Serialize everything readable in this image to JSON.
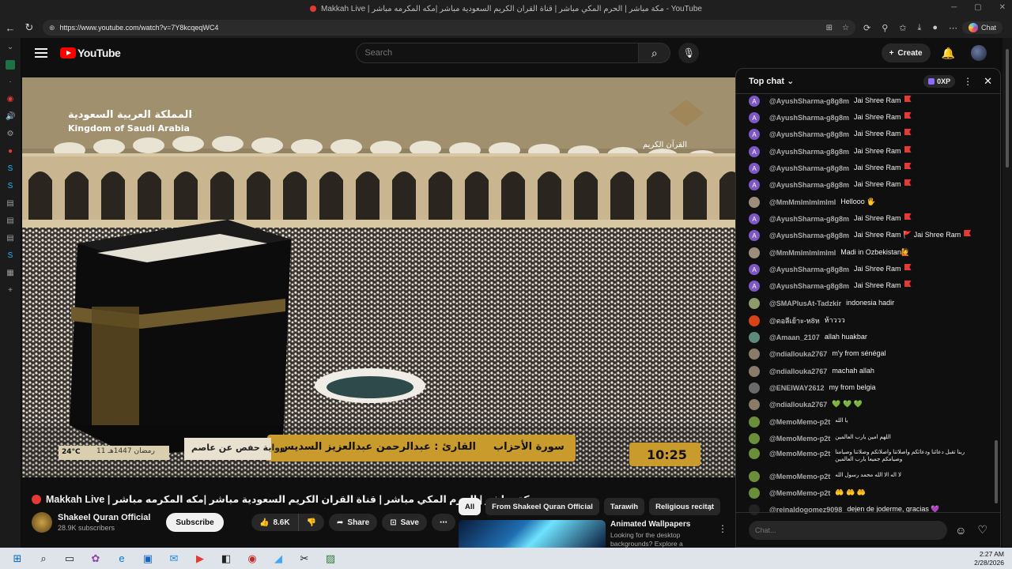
{
  "browser": {
    "tab_title": "Makkah Live | مكة مباشر | الحرم المكي مباشر | قناة القران الكريم السعودية مباشر |مكه المكرمه مباشر - YouTube",
    "url": "https://www.youtube.com/watch?v=7Y8kcqeqWC4",
    "chat_button": "Chat"
  },
  "youtube": {
    "logo_text": "YouTube",
    "search_placeholder": "Search",
    "create_label": "Create"
  },
  "video_overlay": {
    "kingdom_ar": "المملكة العربية السعودية",
    "kingdom_en": "Kingdom of Saudi Arabia",
    "channel_ar": "القرآن الكريم",
    "surah": "سورة الأحزاب",
    "reader": "القارئ : عبدالرحمن عبدالعزيز السديس",
    "riwaya": "رواية حفص عن عاصم",
    "hijri_date": "11 رمضان 1447هـ",
    "temperature": "24°C",
    "clock": "10:25"
  },
  "video": {
    "title": "Makkah Live | مكة مباشر | الحرم المكي مباشر | قناة القران الكريم السعودية مباشر |مكه المكرمه مباشر",
    "channel_name": "Shakeel Quran Official",
    "subscribers": "28.9K subscribers",
    "subscribe_label": "Subscribe",
    "likes": "8.6K",
    "share_label": "Share",
    "save_label": "Save"
  },
  "chips": [
    "All",
    "From Shakeel Quran Official",
    "Tarawih",
    "Religious recitat"
  ],
  "recommended": {
    "title": "Animated Wallpapers",
    "desc": "Looking for the desktop backgrounds? Explore a curated"
  },
  "chat": {
    "header": "Top chat",
    "xp": "0XP",
    "input_placeholder": "Chat...",
    "messages": [
      {
        "author": "@AyushSharma-g8g8m",
        "text": "Jai Shree Ram",
        "avatar": "A",
        "color": "#7e57c2",
        "flag": true
      },
      {
        "author": "@AyushSharma-g8g8m",
        "text": "Jai Shree Ram",
        "avatar": "A",
        "color": "#7e57c2",
        "flag": true
      },
      {
        "author": "@AyushSharma-g8g8m",
        "text": "Jai Shree Ram",
        "avatar": "A",
        "color": "#7e57c2",
        "flag": true
      },
      {
        "author": "@AyushSharma-g8g8m",
        "text": "Jai Shree Ram",
        "avatar": "A",
        "color": "#7e57c2",
        "flag": true
      },
      {
        "author": "@AyushSharma-g8g8m",
        "text": "Jai Shree Ram",
        "avatar": "A",
        "color": "#7e57c2",
        "flag": true
      },
      {
        "author": "@AyushSharma-g8g8m",
        "text": "Jai Shree Ram",
        "avatar": "A",
        "color": "#7e57c2",
        "flag": true
      },
      {
        "author": "@MmMmlmlmlmlml",
        "text": "Hellooo 🖐",
        "avatar": "",
        "color": "#9e8c7a",
        "flag": false
      },
      {
        "author": "@AyushSharma-g8g8m",
        "text": "Jai Shree Ram",
        "avatar": "A",
        "color": "#7e57c2",
        "flag": true
      },
      {
        "author": "@AyushSharma-g8g8m",
        "text": "Jai Shree Ram 🚩 Jai Shree Ram",
        "avatar": "A",
        "color": "#7e57c2",
        "flag": true
      },
      {
        "author": "@MmMmlmlmlmlml",
        "text": "Madi in Ozbekistan🙋",
        "avatar": "",
        "color": "#9e8c7a",
        "flag": false
      },
      {
        "author": "@AyushSharma-g8g8m",
        "text": "Jai Shree Ram",
        "avatar": "A",
        "color": "#7e57c2",
        "flag": true
      },
      {
        "author": "@AyushSharma-g8g8m",
        "text": "Jai Shree Ram",
        "avatar": "A",
        "color": "#7e57c2",
        "flag": true
      },
      {
        "author": "@SMAPlusAt-Tadzkir",
        "text": "indonesia hadir",
        "avatar": "",
        "color": "#8d9a6a",
        "flag": false
      },
      {
        "author": "@ดอลีเย้าะ-ห8ห",
        "text": "ห้าววว",
        "avatar": "",
        "color": "#d84315",
        "flag": false
      },
      {
        "author": "@Amaan_2107",
        "text": "allah huakbar",
        "avatar": "",
        "color": "#5d8a7a",
        "flag": false
      },
      {
        "author": "@ndiallouka2767",
        "text": "m'y from sénégal",
        "avatar": "",
        "color": "#8a7a6a",
        "flag": false
      },
      {
        "author": "@ndiallouka2767",
        "text": "machah allah",
        "avatar": "",
        "color": "#8a7a6a",
        "flag": false
      },
      {
        "author": "@ENEIWAY2612",
        "text": "my from belgia",
        "avatar": "",
        "color": "#6a6a6a",
        "flag": false
      },
      {
        "author": "@ndiallouka2767",
        "text": "💚 💚 💚",
        "avatar": "",
        "color": "#8a7a6a",
        "flag": false
      },
      {
        "author": "@MemoMemo-p2t",
        "text": "يا الله",
        "avatar": "",
        "color": "#6b8e3a",
        "flag": false
      },
      {
        "author": "@MemoMemo-p2t",
        "text": "اللهم امين يارب العالمين",
        "avatar": "",
        "color": "#6b8e3a",
        "flag": false
      },
      {
        "author": "@MemoMemo-p2t",
        "text": "ربنا تقبل دعائنا ودعائكم واصلاتنا واصلاتكم وصلاتنا وصيامنا وصيامكم جميعا يارب العالمين",
        "avatar": "",
        "color": "#6b8e3a",
        "flag": false
      },
      {
        "author": "@MemoMemo-p2t",
        "text": "لا اله الا الله محمد رسول الله",
        "avatar": "",
        "color": "#6b8e3a",
        "flag": false
      },
      {
        "author": "@MemoMemo-p2t",
        "text": "🤲 🤲 🤲",
        "avatar": "",
        "color": "#6b8e3a",
        "flag": false
      },
      {
        "author": "@reinaldogomez9098",
        "text": "dejen de joderme, gracias 💜",
        "avatar": "",
        "color": "#222222",
        "flag": false
      }
    ]
  },
  "taskbar": {
    "time": "2:27 AM",
    "date": "2/28/2026"
  }
}
